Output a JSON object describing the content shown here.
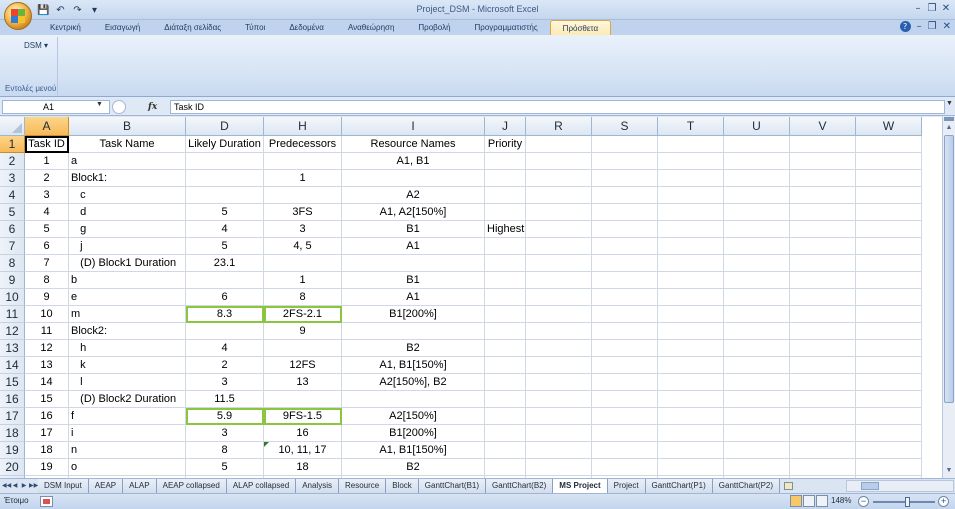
{
  "window": {
    "title": "Project_DSM - Microsoft Excel",
    "minimize": "–",
    "restore": "❐",
    "close": "✕"
  },
  "qat": {
    "save": "💾",
    "undo": "↶",
    "redo": "↷",
    "customize": "▾"
  },
  "ribbon": {
    "tabs": [
      {
        "label": "Κεντρική",
        "active": false
      },
      {
        "label": "Εισαγωγή",
        "active": false
      },
      {
        "label": "Διάταξη σελίδας",
        "active": false
      },
      {
        "label": "Τύποι",
        "active": false
      },
      {
        "label": "Δεδομένα",
        "active": false
      },
      {
        "label": "Αναθεώρηση",
        "active": false
      },
      {
        "label": "Προβολή",
        "active": false
      },
      {
        "label": "Προγραμματιστής",
        "active": false
      },
      {
        "label": "Πρόσθετα",
        "active": true
      }
    ],
    "help": "?",
    "dsm_menu": "DSM ▾",
    "group_label": "Εντολές μενού"
  },
  "formula_bar": {
    "name_box": "A1",
    "fx": "fx",
    "value": "Task ID"
  },
  "columns": [
    {
      "letter": "",
      "width": 25
    },
    {
      "letter": "A",
      "width": 44,
      "selected": true
    },
    {
      "letter": "B",
      "width": 117
    },
    {
      "letter": "D",
      "width": 78
    },
    {
      "letter": "H",
      "width": 78
    },
    {
      "letter": "I",
      "width": 143
    },
    {
      "letter": "J",
      "width": 41
    },
    {
      "letter": "R",
      "width": 66
    },
    {
      "letter": "S",
      "width": 66
    },
    {
      "letter": "T",
      "width": 66
    },
    {
      "letter": "U",
      "width": 66
    },
    {
      "letter": "V",
      "width": 66
    },
    {
      "letter": "W",
      "width": 66
    }
  ],
  "rows": [
    {
      "num": "1",
      "cells": [
        "Task ID",
        "Task Name",
        "Likely Duration",
        "Predecessors",
        "Resource Names",
        "Priority"
      ]
    },
    {
      "num": "2",
      "cells": [
        "1",
        "a",
        "",
        "",
        "A1, B1",
        ""
      ]
    },
    {
      "num": "3",
      "cells": [
        "2",
        "Block1:",
        "",
        "1",
        "",
        ""
      ]
    },
    {
      "num": "4",
      "cells": [
        "3",
        "   c",
        "",
        "",
        "A2",
        ""
      ]
    },
    {
      "num": "5",
      "cells": [
        "4",
        "   d",
        "5",
        "3FS",
        "A1, A2[150%]",
        ""
      ]
    },
    {
      "num": "6",
      "cells": [
        "5",
        "   g",
        "4",
        "3",
        "B1",
        "Highest"
      ]
    },
    {
      "num": "7",
      "cells": [
        "6",
        "   j",
        "5",
        "4, 5",
        "A1",
        ""
      ]
    },
    {
      "num": "8",
      "cells": [
        "7",
        "   (D) Block1 Duration",
        "23.1",
        "",
        "",
        ""
      ]
    },
    {
      "num": "9",
      "cells": [
        "8",
        "b",
        "",
        "1",
        "B1",
        ""
      ]
    },
    {
      "num": "10",
      "cells": [
        "9",
        "e",
        "6",
        "8",
        "A1",
        ""
      ]
    },
    {
      "num": "11",
      "cells": [
        "10",
        "m",
        "8.3",
        "2FS-2.1",
        "B1[200%]",
        ""
      ]
    },
    {
      "num": "12",
      "cells": [
        "11",
        "Block2:",
        "",
        "9",
        "",
        ""
      ]
    },
    {
      "num": "13",
      "cells": [
        "12",
        "   h",
        "4",
        "",
        "B2",
        ""
      ]
    },
    {
      "num": "14",
      "cells": [
        "13",
        "   k",
        "2",
        "12FS",
        "A1, B1[150%]",
        ""
      ]
    },
    {
      "num": "15",
      "cells": [
        "14",
        "   l",
        "3",
        "13",
        "A2[150%], B2",
        ""
      ]
    },
    {
      "num": "16",
      "cells": [
        "15",
        "   (D) Block2 Duration",
        "11.5",
        "",
        "",
        ""
      ]
    },
    {
      "num": "17",
      "cells": [
        "16",
        "f",
        "5.9",
        "9FS-1.5",
        "A2[150%]",
        ""
      ]
    },
    {
      "num": "18",
      "cells": [
        "17",
        "i",
        "3",
        "16",
        "B1[200%]",
        ""
      ]
    },
    {
      "num": "19",
      "cells": [
        "18",
        "n",
        "8",
        "10, 11, 17",
        "A1, B1[150%]",
        ""
      ]
    },
    {
      "num": "20",
      "cells": [
        "19",
        "o",
        "5",
        "18",
        "B2",
        ""
      ]
    },
    {
      "num": "21",
      "cells": [
        "",
        "",
        "",
        "",
        "",
        ""
      ]
    }
  ],
  "highlighted_cells": [
    "10-2",
    "10-3",
    "16-2",
    "16-3"
  ],
  "sheet_tabs": [
    {
      "label": "DSM Input",
      "active": false
    },
    {
      "label": "AEAP",
      "active": false
    },
    {
      "label": "ALAP",
      "active": false
    },
    {
      "label": "AEAP collapsed",
      "active": false
    },
    {
      "label": "ALAP collapsed",
      "active": false
    },
    {
      "label": "Analysis",
      "active": false
    },
    {
      "label": "Resource",
      "active": false
    },
    {
      "label": "Block",
      "active": false
    },
    {
      "label": "GanttChart(B1)",
      "active": false
    },
    {
      "label": "GanttChart(B2)",
      "active": false
    },
    {
      "label": "MS Project",
      "active": true
    },
    {
      "label": "Project",
      "active": false
    },
    {
      "label": "GanttChart(P1)",
      "active": false
    },
    {
      "label": "GanttChart(P2)",
      "active": false
    }
  ],
  "status": {
    "ready": "Έτοιμο",
    "zoom": "148%",
    "zoom_out": "−",
    "zoom_in": "+",
    "zoom_fraction": 0.55
  },
  "colors": {
    "selected_header": "#f8b858",
    "highlight_border": "#8cc63f",
    "active_tab": "#fde9b0"
  }
}
